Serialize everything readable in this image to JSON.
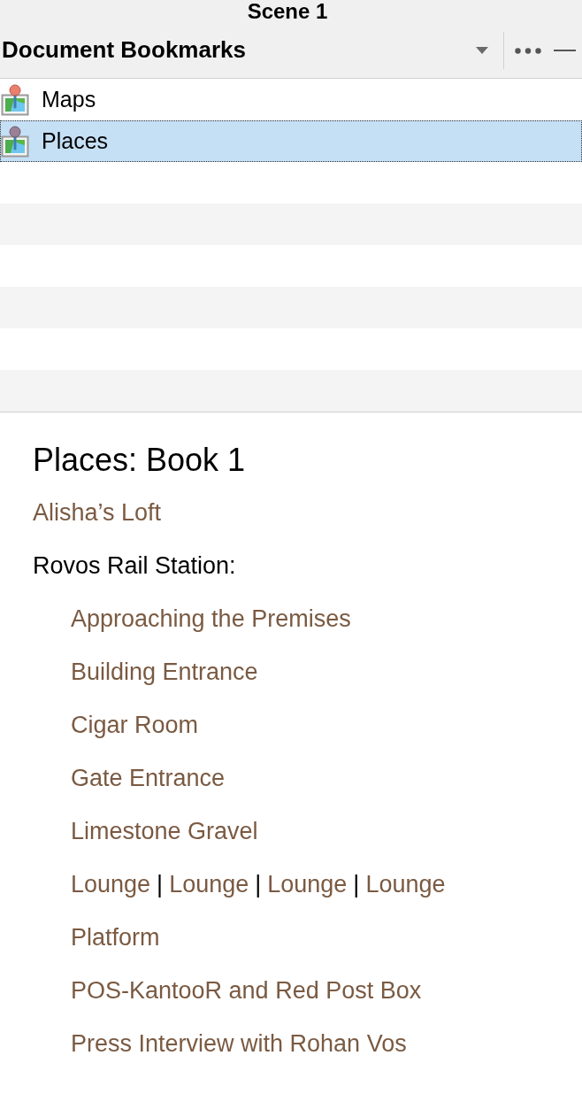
{
  "window": {
    "title": "Scene 1"
  },
  "panel": {
    "title": "Document Bookmarks"
  },
  "bookmarks": [
    {
      "label": "Maps",
      "selected": false
    },
    {
      "label": "Places",
      "selected": true
    }
  ],
  "document": {
    "title": "Places: Book 1",
    "entries": [
      {
        "parts": [
          {
            "kind": "link",
            "text": "Alisha’s Loft"
          }
        ]
      },
      {
        "parts": [
          {
            "kind": "text",
            "text": "Rovos Rail Station:"
          }
        ],
        "children": [
          {
            "parts": [
              {
                "kind": "link",
                "text": "Approaching the Premises"
              }
            ]
          },
          {
            "parts": [
              {
                "kind": "link",
                "text": "Building Entrance"
              }
            ]
          },
          {
            "parts": [
              {
                "kind": "link",
                "text": "Cigar Room"
              }
            ]
          },
          {
            "parts": [
              {
                "kind": "link",
                "text": "Gate Entrance"
              }
            ]
          },
          {
            "parts": [
              {
                "kind": "link",
                "text": "Limestone Gravel"
              }
            ]
          },
          {
            "parts": [
              {
                "kind": "link",
                "text": "Lounge"
              },
              {
                "kind": "separator",
                "text": "|"
              },
              {
                "kind": "link",
                "text": "Lounge"
              },
              {
                "kind": "separator",
                "text": "|"
              },
              {
                "kind": "link",
                "text": "Lounge"
              },
              {
                "kind": "separator",
                "text": "|"
              },
              {
                "kind": "link",
                "text": "Lounge"
              }
            ]
          },
          {
            "parts": [
              {
                "kind": "link",
                "text": "Platform"
              }
            ]
          },
          {
            "parts": [
              {
                "kind": "link",
                "text": "POS-KantooR and Red Post Box"
              }
            ]
          },
          {
            "parts": [
              {
                "kind": "link",
                "text": "Press Interview with Rohan Vos"
              }
            ]
          }
        ]
      }
    ]
  }
}
